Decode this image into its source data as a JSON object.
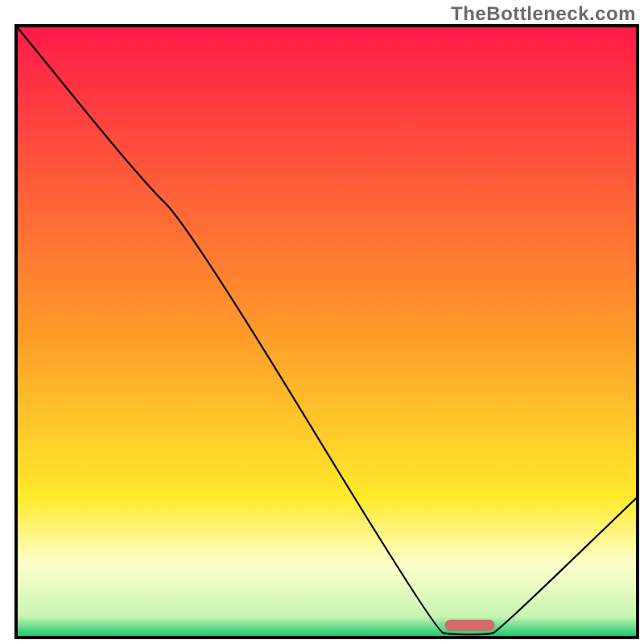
{
  "watermark": "TheBottleneck.com",
  "chart_data": {
    "type": "line",
    "title": "",
    "xlabel": "",
    "ylabel": "",
    "xlim": [
      0,
      100
    ],
    "ylim": [
      0,
      100
    ],
    "background_gradient": [
      {
        "offset": 0.0,
        "color": "#ff1a49"
      },
      {
        "offset": 0.5,
        "color": "#ff9a2a"
      },
      {
        "offset": 0.77,
        "color": "#ffea2a"
      },
      {
        "offset": 0.88,
        "color": "#ffffcc"
      },
      {
        "offset": 0.965,
        "color": "#c9f5b4"
      },
      {
        "offset": 1.0,
        "color": "#10c46b"
      }
    ],
    "curve": [
      {
        "x": 0.0,
        "y": 100.0
      },
      {
        "x": 20.0,
        "y": 75.0
      },
      {
        "x": 28.0,
        "y": 67.0
      },
      {
        "x": 67.5,
        "y": 1.0
      },
      {
        "x": 70.0,
        "y": 0.5
      },
      {
        "x": 76.0,
        "y": 0.5
      },
      {
        "x": 77.5,
        "y": 1.0
      },
      {
        "x": 100.0,
        "y": 23.0
      }
    ],
    "marker": {
      "x": 73.0,
      "y": 2.0,
      "width": 8.0,
      "color": "#d46a6a"
    },
    "frame_color": "#000000",
    "curve_color": "#000000"
  }
}
